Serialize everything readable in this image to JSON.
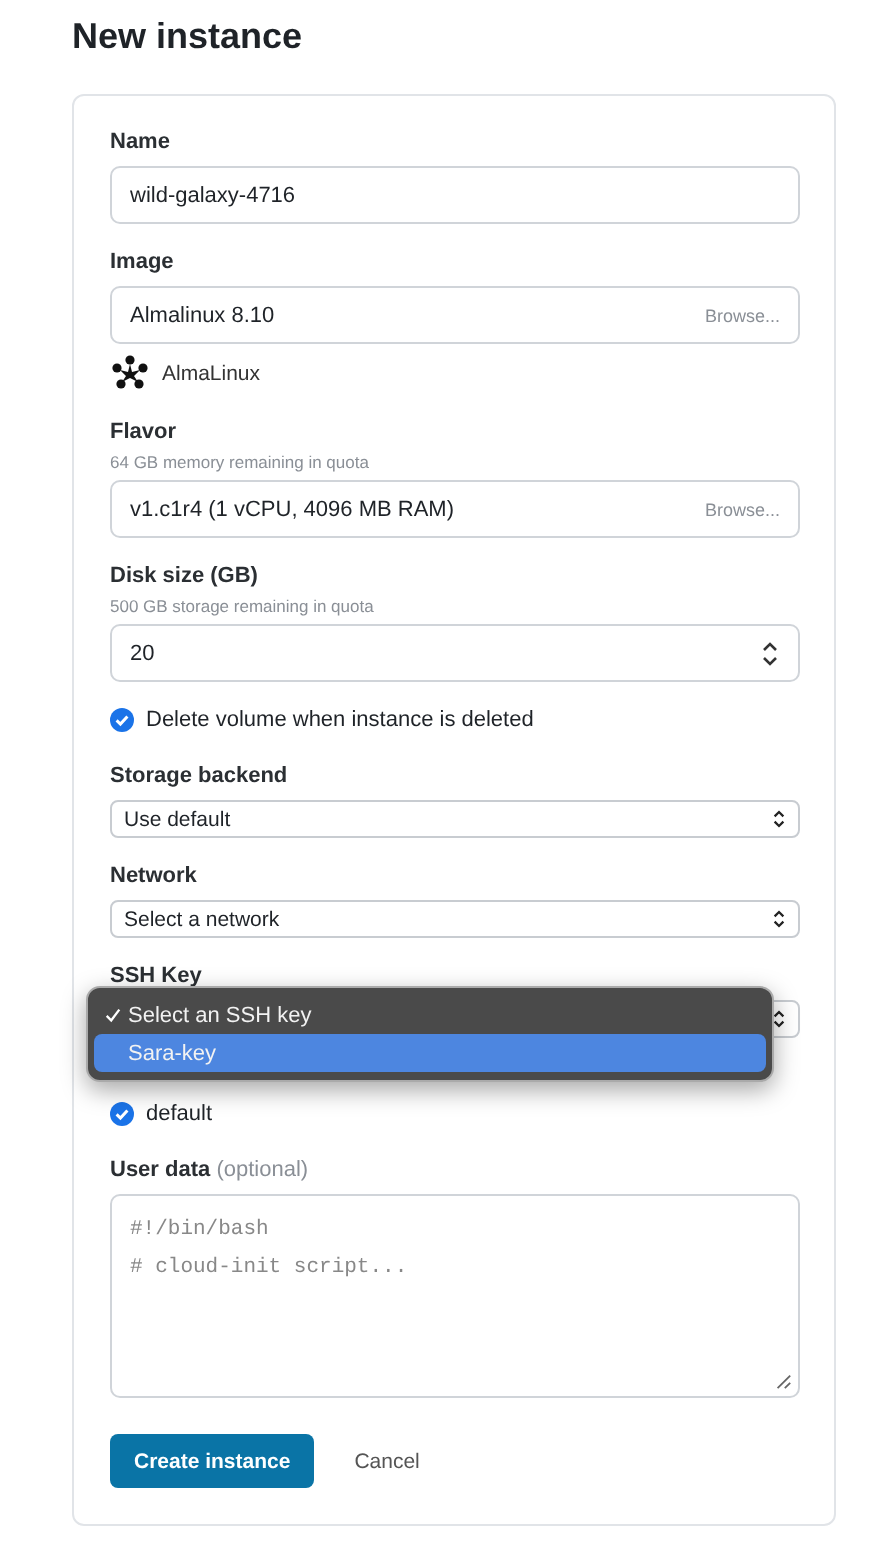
{
  "title": "New instance",
  "fields": [
    {
      "kind": "text",
      "label": "Name",
      "value": "wild-galaxy-4716"
    },
    {
      "kind": "browse",
      "label": "Image",
      "value": "Almalinux 8.10",
      "action": "Browse...",
      "caption": "AlmaLinux"
    },
    {
      "kind": "browse",
      "label": "Flavor",
      "hint": "64 GB memory remaining in quota",
      "value": "v1.c1r4 (1 vCPU, 4096 MB RAM)",
      "action": "Browse..."
    },
    {
      "kind": "number",
      "label": "Disk size (GB)",
      "hint": "500 GB storage remaining in quota",
      "value": "20"
    },
    {
      "kind": "checkbox",
      "label": "Delete volume when instance is deleted",
      "checked": true
    },
    {
      "kind": "select",
      "label": "Storage backend",
      "value": "Use default"
    },
    {
      "kind": "select",
      "label": "Network",
      "value": "Select a network"
    },
    {
      "kind": "select",
      "label": "SSH Key",
      "open": true,
      "options": [
        {
          "label": "Select an SSH key",
          "checked": true,
          "selected": false
        },
        {
          "label": "Sara-key",
          "checked": false,
          "selected": true
        }
      ]
    },
    {
      "kind": "checkbox",
      "label": "default",
      "checked": true
    },
    {
      "kind": "textarea",
      "label": "User data",
      "optional": "(optional)",
      "placeholder": "#!/bin/bash\n# cloud-init script..."
    }
  ],
  "buttons": [
    {
      "label": "Create instance",
      "kind": "primary"
    },
    {
      "label": "Cancel",
      "kind": "link"
    }
  ]
}
